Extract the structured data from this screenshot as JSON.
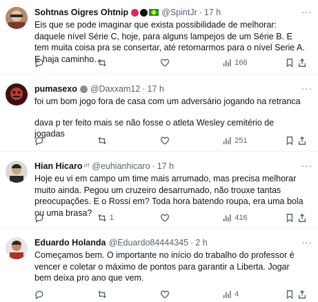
{
  "tweets": [
    {
      "name": "Sohtnas Oigres Ohtnip",
      "handle": "@SpintJr",
      "time": "17 h",
      "text": [
        "Eis que se pode imaginar que exista possibilidade de melhorar: daquele nível Série C, hoje, para alguns lampejos de um Série B. E tem muita coisa pra se consertar, até retornarmos para o nível Serie A. E haja caminho…"
      ],
      "replies": "",
      "retweets": "",
      "likes": "",
      "views": "166",
      "avatar_color": "#c9a27e",
      "name_emojis": [
        "red-circle",
        "black-circle",
        "brazil-flag"
      ]
    },
    {
      "name": "pumasexo",
      "handle": "@Daxxam12",
      "time": "17 h",
      "text": [
        "foi um bom jogo fora de casa com um adversário jogando na retranca",
        "dava p ter feito mais se não fosse o atleta Wesley cemitério de jogadas"
      ],
      "replies": "",
      "retweets": "",
      "likes": "",
      "views": "251",
      "avatar_color": "#5a1f1f",
      "name_emojis": [
        "horror-face"
      ]
    },
    {
      "name": "Hian Hicaro",
      "name_badge": "crf",
      "handle": "@euhianhicaro",
      "time": "17 h",
      "text": [
        "Hoje eu vi em campo um time mais arrumado, mas precisa melhorar muito ainda. Pegou um cruzeiro desarrumado, não trouxe tantas preocupações. E o Rossi em? Toda hora batendo roupa, era uma bola ou uma brasa?"
      ],
      "replies": "",
      "retweets": "1",
      "likes": "",
      "views": "416",
      "avatar_color": "#3b3b3b"
    },
    {
      "name": "Eduardo Holanda",
      "handle": "@Eduardo84444345",
      "time": "2 h",
      "text": [
        "Começamos bem. O importante no início do trabalho do professor é vencer e coletar o máximo de pontos para garantir a Liberta. Jogar bem deixa pro ano que vem."
      ],
      "replies": "",
      "retweets": "",
      "likes": "",
      "views": "4",
      "avatar_color": "#8b3a2f"
    }
  ],
  "more_label": "···",
  "dot": "·",
  "icons": [
    "reply-icon",
    "retweet-icon",
    "like-icon",
    "views-icon",
    "bookmark-icon",
    "share-icon"
  ]
}
